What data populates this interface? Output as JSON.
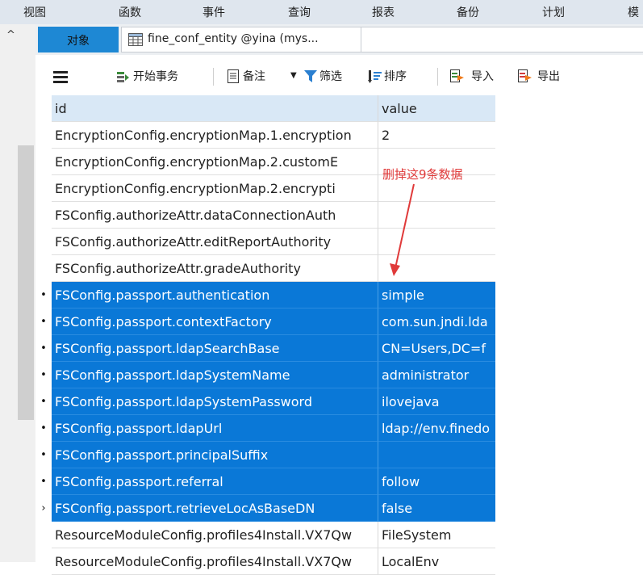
{
  "menubar": {
    "items": [
      "视图",
      "函数",
      "事件",
      "查询",
      "报表",
      "备份",
      "计划",
      "模"
    ]
  },
  "tabs": {
    "objects_label": "对象",
    "entity_tab_label": "fine_conf_entity @yina (mys..."
  },
  "gutter": {
    "collapse_glyph": "^"
  },
  "toolbar": {
    "begin_transaction": "开始事务",
    "note": "备注",
    "filter": "筛选",
    "sort": "排序",
    "import": "导入",
    "export": "导出"
  },
  "grid": {
    "columns": [
      "id",
      "value"
    ],
    "rows": [
      {
        "mark": "",
        "id": "EncryptionConfig.encryptionMap.1.encryption",
        "value": "2",
        "selected": false
      },
      {
        "mark": "",
        "id": "EncryptionConfig.encryptionMap.2.customE",
        "value": "",
        "selected": false
      },
      {
        "mark": "",
        "id": "EncryptionConfig.encryptionMap.2.encrypti",
        "value": "",
        "selected": false
      },
      {
        "mark": "",
        "id": "FSConfig.authorizeAttr.dataConnectionAuth",
        "value": "",
        "selected": false
      },
      {
        "mark": "",
        "id": "FSConfig.authorizeAttr.editReportAuthority",
        "value": "",
        "selected": false
      },
      {
        "mark": "",
        "id": "FSConfig.authorizeAttr.gradeAuthority",
        "value": "",
        "selected": false
      },
      {
        "mark": "•",
        "id": "FSConfig.passport.authentication",
        "value": "simple",
        "selected": true
      },
      {
        "mark": "•",
        "id": "FSConfig.passport.contextFactory",
        "value": "com.sun.jndi.lda",
        "selected": true
      },
      {
        "mark": "•",
        "id": "FSConfig.passport.ldapSearchBase",
        "value": "CN=Users,DC=f",
        "selected": true
      },
      {
        "mark": "•",
        "id": "FSConfig.passport.ldapSystemName",
        "value": "administrator",
        "selected": true
      },
      {
        "mark": "•",
        "id": "FSConfig.passport.ldapSystemPassword",
        "value": "ilovejava",
        "selected": true
      },
      {
        "mark": "•",
        "id": "FSConfig.passport.ldapUrl",
        "value": "ldap://env.finedo",
        "selected": true
      },
      {
        "mark": "•",
        "id": "FSConfig.passport.principalSuffix",
        "value": "",
        "selected": true
      },
      {
        "mark": "•",
        "id": "FSConfig.passport.referral",
        "value": "follow",
        "selected": true
      },
      {
        "mark": "›",
        "id": "FSConfig.passport.retrieveLocAsBaseDN",
        "value": "false",
        "selected": true
      },
      {
        "mark": "",
        "id": "ResourceModuleConfig.profiles4Install.VX7Qw",
        "value": "FileSystem",
        "selected": false
      },
      {
        "mark": "",
        "id": "ResourceModuleConfig.profiles4Install.VX7Qw",
        "value": "LocalEnv",
        "selected": false
      }
    ]
  },
  "annotation": {
    "text": "删掉这9条数据",
    "color": "#e03a3a"
  },
  "colors": {
    "selection": "#0a78d7",
    "header": "#d9e8f6",
    "menubar": "#dfe6ee"
  }
}
